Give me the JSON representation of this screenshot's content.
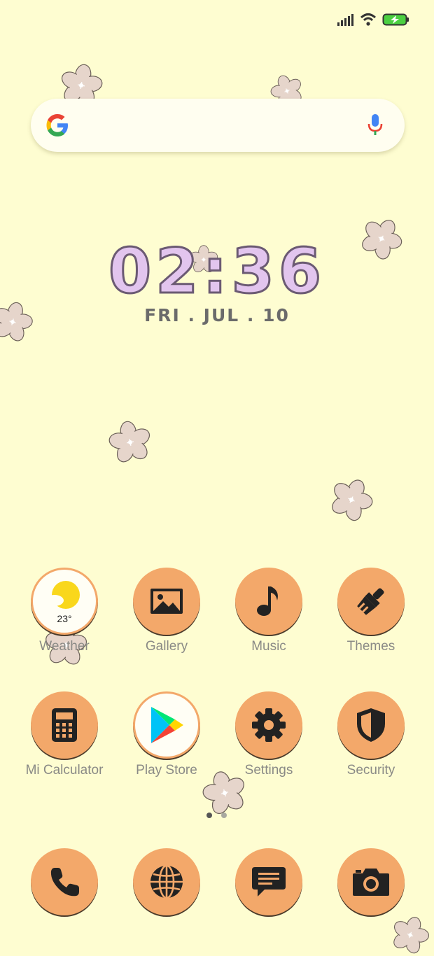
{
  "status_bar": {
    "icons": [
      "signal-icon",
      "wifi-icon",
      "battery-charging-icon"
    ]
  },
  "search": {
    "placeholder": ""
  },
  "clock": {
    "time": "02:36",
    "date": "FRI . JUL . 10"
  },
  "weather": {
    "temperature": "23°"
  },
  "apps": [
    {
      "label": "Weather",
      "icon": "weather-icon"
    },
    {
      "label": "Gallery",
      "icon": "gallery-icon"
    },
    {
      "label": "Music",
      "icon": "music-icon"
    },
    {
      "label": "Themes",
      "icon": "themes-icon"
    },
    {
      "label": "Mi Calculator",
      "icon": "calculator-icon"
    },
    {
      "label": "Play Store",
      "icon": "play-store-icon"
    },
    {
      "label": "Settings",
      "icon": "settings-icon"
    },
    {
      "label": "Security",
      "icon": "security-icon"
    }
  ],
  "dock": [
    {
      "icon": "phone-icon"
    },
    {
      "icon": "browser-icon"
    },
    {
      "icon": "messages-icon"
    },
    {
      "icon": "camera-icon"
    }
  ],
  "page_indicator": {
    "pages": 2,
    "current": 1
  },
  "colors": {
    "background": "#fefdd1",
    "icon_bg": "#f3a86a",
    "clock_fill": "#e2c5ee"
  }
}
